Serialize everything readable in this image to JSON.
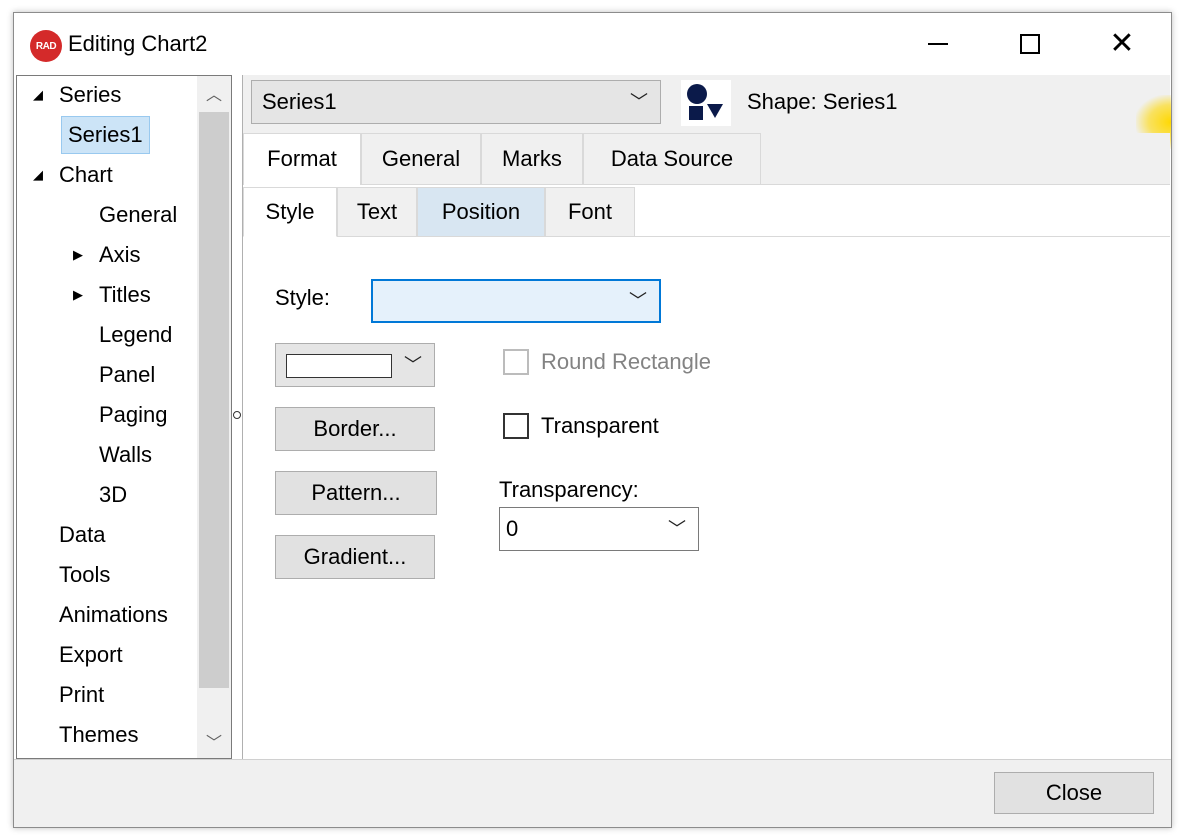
{
  "window": {
    "app_icon_text": "RAD",
    "title": "Editing Chart2",
    "minimize_label": "—",
    "close_symbol": "✕"
  },
  "tree": {
    "items": [
      {
        "label": "Series",
        "expanded": true
      },
      {
        "label": "Series1",
        "selected": true
      },
      {
        "label": "Chart",
        "expanded": true
      },
      {
        "label": "General"
      },
      {
        "label": "Axis",
        "collapsed": true
      },
      {
        "label": "Titles",
        "collapsed": true
      },
      {
        "label": "Legend"
      },
      {
        "label": "Panel"
      },
      {
        "label": "Paging"
      },
      {
        "label": "Walls"
      },
      {
        "label": "3D"
      },
      {
        "label": "Data"
      },
      {
        "label": "Tools"
      },
      {
        "label": "Animations"
      },
      {
        "label": "Export"
      },
      {
        "label": "Print"
      },
      {
        "label": "Themes"
      }
    ]
  },
  "header": {
    "series_selected": "Series1",
    "shape_label": "Shape: Series1"
  },
  "tabs": [
    "Format",
    "General",
    "Marks",
    "Data Source"
  ],
  "subtabs": [
    "Style",
    "Text",
    "Position",
    "Font"
  ],
  "format": {
    "style_label": "Style:",
    "style_value": "",
    "round_rectangle_label": "Round Rectangle",
    "round_rectangle_checked": false,
    "round_rectangle_enabled": false,
    "border_button": "Border...",
    "transparent_label": "Transparent",
    "transparent_checked": false,
    "pattern_button": "Pattern...",
    "transparency_label": "Transparency:",
    "transparency_value": "0",
    "gradient_button": "Gradient..."
  },
  "footer": {
    "close_button": "Close"
  },
  "colors": {
    "accent": "#0078d7",
    "selection": "#cce4f7",
    "app_icon": "#d42a2a"
  }
}
